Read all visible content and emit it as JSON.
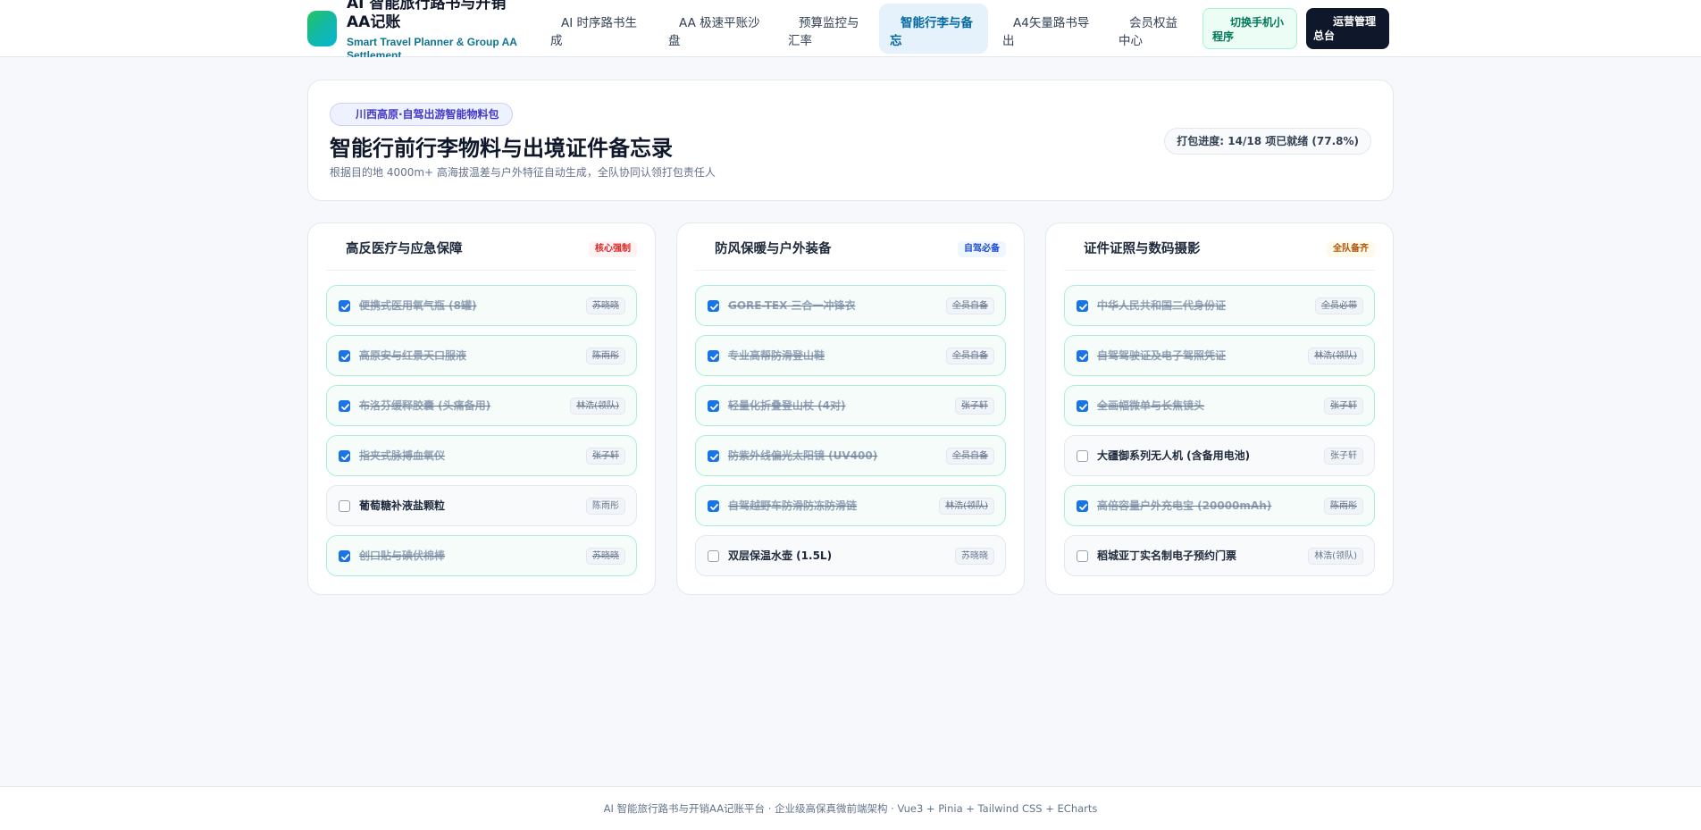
{
  "header": {
    "brand_title": "AI 智能旅行路书与开销AA记账",
    "brand_subtitle": "Smart Travel Planner & Group AA Settlement",
    "nav": [
      {
        "label": "AI 时序路书生成",
        "active": false
      },
      {
        "label": "AA 极速平账沙盘",
        "active": false
      },
      {
        "label": "预算监控与汇率",
        "active": false
      },
      {
        "label": "智能行李与备忘",
        "active": true
      },
      {
        "label": "A4矢量路书导出",
        "active": false
      },
      {
        "label": "会员权益中心",
        "active": false
      }
    ],
    "mini_program_label": "切换手机小程序",
    "admin_label": "运营管理总台"
  },
  "hero": {
    "tag": "川西高原·自驾出游智能物料包",
    "title": "智能行前行李物料与出境证件备忘录",
    "description": "根据目的地 4000m+ 高海拔温差与户外特征自动生成，全队协同认领打包责任人",
    "progress_text": "打包进度: 14/18 项已就绪 (77.8%)",
    "packed": 14,
    "total": 18
  },
  "columns": [
    {
      "title": "高反医疗与应急保障",
      "badge": "核心强制",
      "badge_color": "#dc2626",
      "items": [
        {
          "label": "便携式医用氧气瓶 (8罐)",
          "owner": "苏晓晓",
          "checked": true
        },
        {
          "label": "高原安与红景天口服液",
          "owner": "陈雨彤",
          "checked": true
        },
        {
          "label": "布洛芬缓释胶囊 (头痛备用)",
          "owner": "林浩(领队)",
          "checked": true
        },
        {
          "label": "指夹式脉搏血氧仪",
          "owner": "张子轩",
          "checked": true
        },
        {
          "label": "葡萄糖补液盐颗粒",
          "owner": "陈雨彤",
          "checked": false
        },
        {
          "label": "创口贴与碘伏棉棒",
          "owner": "苏晓晓",
          "checked": true
        }
      ]
    },
    {
      "title": "防风保暖与户外装备",
      "badge": "自驾必备",
      "badge_color": "#1d4ed8",
      "items": [
        {
          "label": "GORE-TEX 三合一冲锋衣",
          "owner": "全员自备",
          "checked": true
        },
        {
          "label": "专业高帮防滑登山鞋",
          "owner": "全员自备",
          "checked": true
        },
        {
          "label": "轻量化折叠登山杖 (4对)",
          "owner": "张子轩",
          "checked": true
        },
        {
          "label": "防紫外线偏光太阳镜 (UV400)",
          "owner": "全员自备",
          "checked": true
        },
        {
          "label": "自驾越野车防滑防冻防滑链",
          "owner": "林浩(领队)",
          "checked": true
        },
        {
          "label": "双层保温水壶 (1.5L)",
          "owner": "苏晓晓",
          "checked": false
        }
      ]
    },
    {
      "title": "证件证照与数码摄影",
      "badge": "全队备齐",
      "badge_color": "#b45309",
      "items": [
        {
          "label": "中华人民共和国二代身份证",
          "owner": "全员必带",
          "checked": true
        },
        {
          "label": "自驾驾驶证及电子驾照凭证",
          "owner": "林浩(领队)",
          "checked": true
        },
        {
          "label": "全画幅微单与长焦镜头",
          "owner": "张子轩",
          "checked": true
        },
        {
          "label": "大疆御系列无人机 (含备用电池)",
          "owner": "张子轩",
          "checked": false
        },
        {
          "label": "高倍容量户外充电宝 (20000mAh)",
          "owner": "陈雨彤",
          "checked": true
        },
        {
          "label": "稻城亚丁实名制电子预约门票",
          "owner": "林浩(领队)",
          "checked": false
        }
      ]
    }
  ],
  "footer": {
    "text": "AI 智能旅行路书与开销AA记账平台 · 企业级高保真微前端架构 · Vue3 + Pinia + Tailwind CSS + ECharts"
  }
}
